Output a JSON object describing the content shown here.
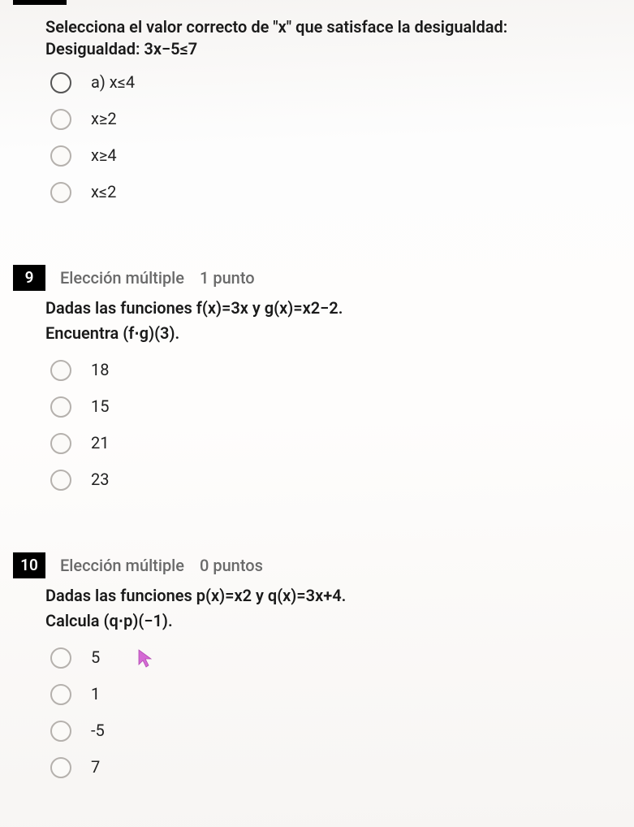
{
  "q8": {
    "stem_line1": "Selecciona el valor correcto de \"x\" que satisface la desigualdad:",
    "stem_line2": "Desigualdad: 3x−5≤7",
    "options": [
      "a) x≤4",
      "x≥2",
      "x≥4",
      "x≤2"
    ]
  },
  "q9": {
    "number": "9",
    "type": "Elección múltiple",
    "points": "1 punto",
    "stem_line1": "Dadas las funciones f(x)=3x y g(x)=x2−2.",
    "stem_line2": "Encuentra (f⋅g)(3).",
    "options": [
      "18",
      "15",
      "21",
      "23"
    ]
  },
  "q10": {
    "number": "10",
    "type": "Elección múltiple",
    "points": "0 puntos",
    "stem_line1": "Dadas las funciones p(x)=x2 y q(x)=3x+4.",
    "stem_line2": "Calcula (q⋅p)(−1).",
    "options": [
      "5",
      "1",
      "-5",
      "7"
    ]
  }
}
